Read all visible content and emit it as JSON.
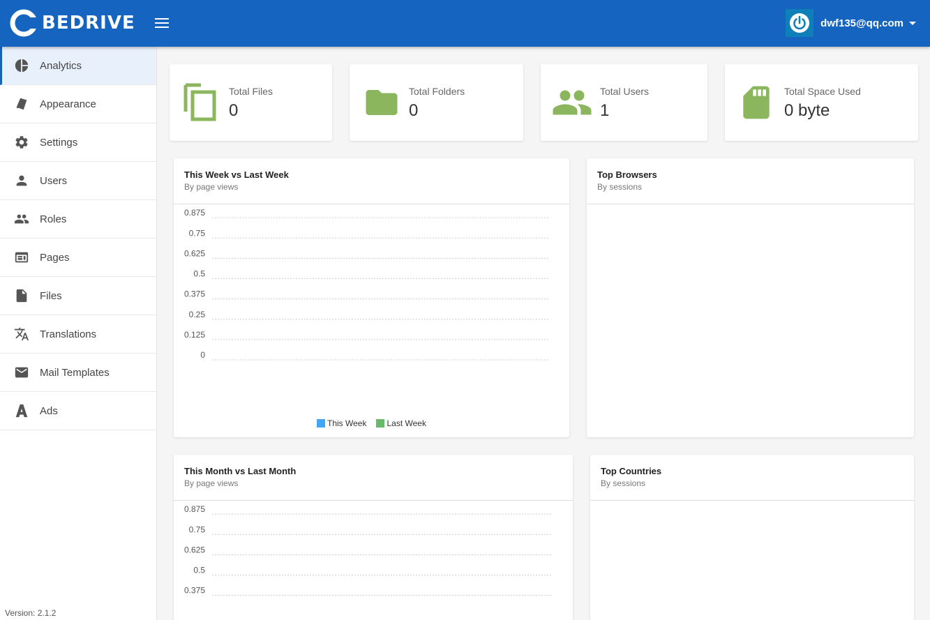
{
  "app": {
    "logo_text": "BEDRIVE"
  },
  "user": {
    "email": "dwf135@qq.com"
  },
  "sidebar": {
    "items": [
      {
        "label": "Analytics",
        "icon": "pie-chart-icon"
      },
      {
        "label": "Appearance",
        "icon": "palette-icon"
      },
      {
        "label": "Settings",
        "icon": "gear-icon"
      },
      {
        "label": "Users",
        "icon": "person-icon"
      },
      {
        "label": "Roles",
        "icon": "people-icon"
      },
      {
        "label": "Pages",
        "icon": "page-icon"
      },
      {
        "label": "Files",
        "icon": "file-icon"
      },
      {
        "label": "Translations",
        "icon": "translate-icon"
      },
      {
        "label": "Mail Templates",
        "icon": "mail-icon"
      },
      {
        "label": "Ads",
        "icon": "ads-icon"
      }
    ],
    "version": "Version: 2.1.2"
  },
  "stats": [
    {
      "label": "Total Files",
      "value": "0",
      "icon": "copy-icon"
    },
    {
      "label": "Total Folders",
      "value": "0",
      "icon": "folder-icon"
    },
    {
      "label": "Total Users",
      "value": "1",
      "icon": "people-icon"
    },
    {
      "label": "Total Space Used",
      "value": "0 byte",
      "icon": "sd-card-icon"
    }
  ],
  "colors": {
    "accent": "#1565c0",
    "stat_icon": "#8bb65e",
    "this_series": "#42a5f5",
    "last_series": "#66bb6a"
  },
  "panels": {
    "week": {
      "title": "This Week vs Last Week",
      "subtitle": "By page views"
    },
    "browsers": {
      "title": "Top Browsers",
      "subtitle": "By sessions"
    },
    "month": {
      "title": "This Month vs Last Month",
      "subtitle": "By page views"
    },
    "countries": {
      "title": "Top Countries",
      "subtitle": "By sessions"
    }
  },
  "chart_data": [
    {
      "type": "line",
      "title": "This Week vs Last Week",
      "subtitle": "By page views",
      "y_ticks": [
        "0",
        "0.125",
        "0.25",
        "0.375",
        "0.5",
        "0.625",
        "0.75",
        "0.875"
      ],
      "ylim": [
        0,
        1
      ],
      "series": [
        {
          "name": "This Week",
          "values": []
        },
        {
          "name": "Last Week",
          "values": []
        }
      ],
      "legend": "bottom",
      "grid": true
    },
    {
      "type": "line",
      "title": "This Month vs Last Month",
      "subtitle": "By page views",
      "y_ticks": [
        "0.375",
        "0.5",
        "0.625",
        "0.75",
        "0.875"
      ],
      "ylim": [
        0,
        1
      ],
      "series": [],
      "grid": true
    }
  ]
}
